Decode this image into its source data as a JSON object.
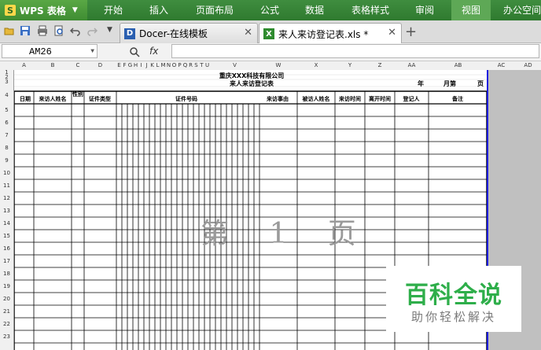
{
  "app": {
    "logo": "S",
    "title": "WPS 表格",
    "dropdown_icon": "chevron-down-icon"
  },
  "menu": [
    "开始",
    "插入",
    "页面布局",
    "公式",
    "数据",
    "表格样式",
    "审阅",
    "视图",
    "办公空间"
  ],
  "active_menu": "视图",
  "tabs": [
    {
      "label": "Docer-在线模板",
      "icon": "docer-icon",
      "active": false
    },
    {
      "label": "来人来访登记表.xls *",
      "icon": "excel-icon",
      "active": true
    }
  ],
  "formula_bar": {
    "cell_ref": "AM26",
    "fx": "fx",
    "value": ""
  },
  "columns": [
    "A",
    "B",
    "C",
    "D",
    "E",
    "F",
    "G",
    "H",
    "I",
    "J",
    "K",
    "L",
    "M",
    "N",
    "O",
    "P",
    "Q",
    "R",
    "S",
    "T",
    "U",
    "V",
    "W",
    "X",
    "Y",
    "Z",
    "AA",
    "AB",
    "AC",
    "AD"
  ],
  "rows": [
    "1",
    "2",
    "3",
    "4",
    "5",
    "6",
    "7",
    "8",
    "9",
    "10",
    "11",
    "12",
    "13",
    "14",
    "15",
    "16",
    "17",
    "18",
    "19",
    "20",
    "21",
    "22",
    "23"
  ],
  "sheet": {
    "company": "重庆XXX科技有限公司",
    "form_title": "来人来访登记表",
    "year_label": "年",
    "month_label": "月第",
    "page_label": "页",
    "headers": [
      "日期",
      "来访人姓名",
      "性别",
      "证件类型",
      "证件号码",
      "来访事由",
      "被访人姓名",
      "来访时间",
      "离开时间",
      "登记人",
      "备注"
    ],
    "page_watermark": "第 1 页"
  },
  "badge": {
    "title": "百科全说",
    "subtitle": "助你轻松解决"
  },
  "colors": {
    "menu_green": "#3f8d3f",
    "page_border": "#1e1ee0",
    "badge_green": "#2eae4a"
  }
}
